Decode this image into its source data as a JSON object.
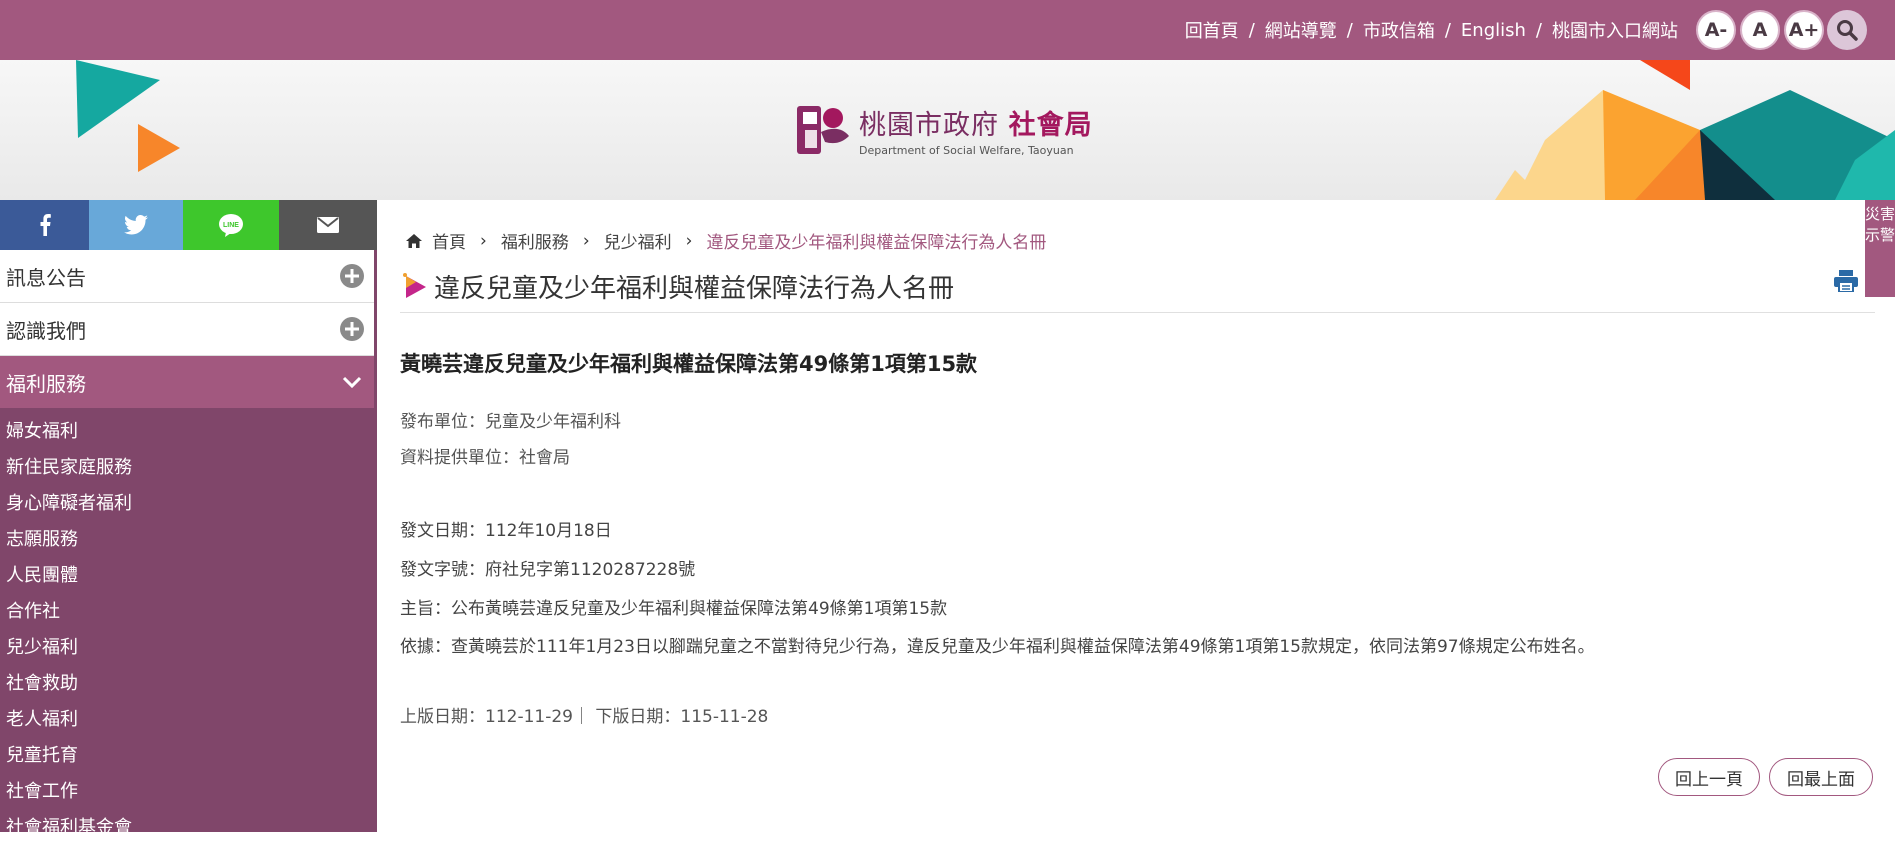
{
  "header": {
    "links": [
      "回首頁",
      "網站導覽",
      "市政信箱",
      "English",
      "桃園市入口網站"
    ],
    "separator": "/",
    "font_small": "A-",
    "font_normal": "A",
    "font_large": "A+",
    "brand_color": "#a2587f"
  },
  "logo": {
    "cn_org": "桃園市政府",
    "cn_dept": "社會局",
    "en": "Department of Social Welfare, Taoyuan"
  },
  "social": {
    "facebook_icon": "facebook-icon",
    "twitter_icon": "twitter-icon",
    "line_label": "LINE",
    "mail_icon": "mail-icon"
  },
  "sidebar": {
    "collapsed": [
      {
        "label": "訊息公告"
      },
      {
        "label": "認識我們"
      }
    ],
    "expanded": {
      "label": "福利服務"
    },
    "items": [
      "婦女福利",
      "新住民家庭服務",
      "身心障礙者福利",
      "志願服務",
      "人民團體",
      "合作社",
      "兒少福利",
      "社會救助",
      "老人福利",
      "兒童托育",
      "社會工作",
      "社會福利基金會"
    ]
  },
  "breadcrumb": {
    "home": "首頁",
    "items": [
      "福利服務",
      "兒少福利"
    ],
    "current": "違反兒童及少年福利與權益保障法行為人名冊",
    "arrow": "›"
  },
  "page": {
    "title": "違反兒童及少年福利與權益保障法行為人名冊"
  },
  "article": {
    "title": "黃曉芸違反兒童及少年福利與權益保障法第49條第1項第15款",
    "publisher": "發布單位：兒童及少年福利科",
    "provider": "資料提供單位：社會局",
    "issue_date": "發文日期：112年10月18日",
    "doc_no": "發文字號：府社兒字第1120287228號",
    "subject": "主旨：公布黃曉芸違反兒童及少年福利與權益保障法第49條第1項第15款",
    "basis": "依據：查黃曉芸於111年1月23日以腳踹兒童之不當對待兒少行為，違反兒童及少年福利與權益保障法第49條第1項第15款規定，依同法第97條規定公布姓名。",
    "dates": "上版日期：112-11-29｜ 下版日期：115-11-28"
  },
  "buttons": {
    "back": "回上一頁",
    "top": "回最上面"
  },
  "alert_tab": "災害示警"
}
